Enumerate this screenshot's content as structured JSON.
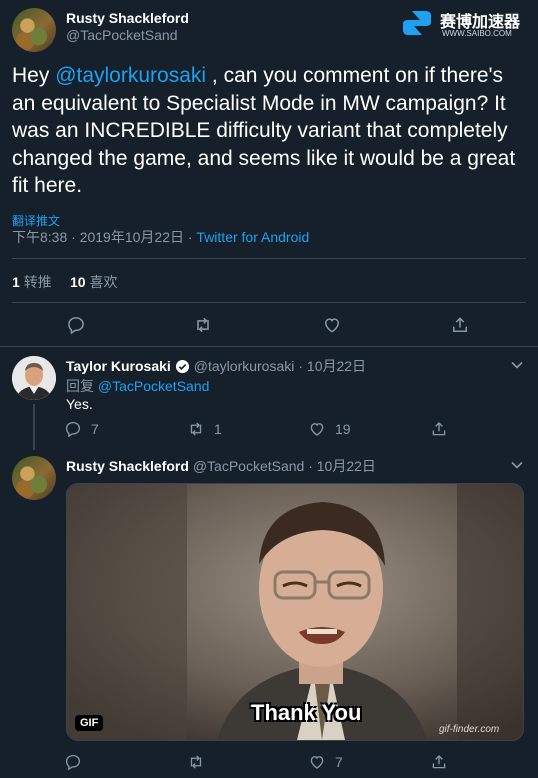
{
  "main_tweet": {
    "author_name": "Rusty Shackleford",
    "author_handle": "@TacPocketSand",
    "text_before": "Hey ",
    "mention": "@taylorkurosaki",
    "text_after": " , can you comment on if there's an equivalent to Specialist Mode in MW campaign? It was an INCREDIBLE difficulty variant that completely changed the game, and seems like it would be a great fit here.",
    "translate_label": "翻译推文",
    "timestamp": "下午8:38 · 2019年10月22日 · ",
    "source": "Twitter for Android",
    "retweet_count": "1",
    "retweet_label": "转推",
    "like_count": "10",
    "like_label": "喜欢"
  },
  "watermark": {
    "brand": "赛博加速器",
    "url": "WWW.SAIBO.COM"
  },
  "reply1": {
    "author_name": "Taylor Kurosaki",
    "author_handle": "@taylorkurosaki",
    "date": "· 10月22日",
    "reply_to_label": "回复 ",
    "reply_to_handle": "@TacPocketSand",
    "text": "Yes.",
    "reply_count": "7",
    "retweet_count": "1",
    "like_count": "19"
  },
  "reply2": {
    "author_name": "Rusty Shackleford",
    "author_handle": "@TacPocketSand",
    "date": "· 10月22日",
    "gif_badge": "GIF",
    "gif_caption": "Thank You",
    "gif_watermark": "gif-finder.com",
    "like_count": "7"
  },
  "colors": {
    "background": "#15202b",
    "accent": "#1da1f2",
    "muted": "#8899a6",
    "border": "#38444d"
  }
}
